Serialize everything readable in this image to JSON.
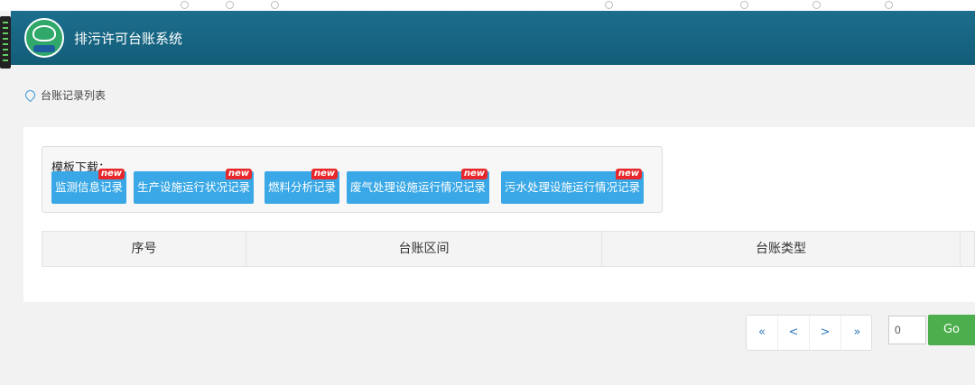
{
  "app": {
    "title": "排污许可台账系统"
  },
  "breadcrumb": {
    "label": "台账记录列表"
  },
  "templates": {
    "label": "模板下载：",
    "badge": "new",
    "buttons": [
      "监测信息记录",
      "生产设施运行状况记录",
      "燃料分析记录",
      "废气处理设施运行情况记录",
      "污水处理设施运行情况记录"
    ]
  },
  "table": {
    "columns": [
      "序号",
      "台账区间",
      "台账类型"
    ]
  },
  "pagination": {
    "first": "«",
    "prev": "<",
    "next": ">",
    "last": "»",
    "page_value": "0",
    "go_label": "Go"
  },
  "colors": {
    "header": "#176782",
    "template_button": "#3aa8e6",
    "badge": "#e8282b",
    "go_button": "#4cae4c"
  }
}
